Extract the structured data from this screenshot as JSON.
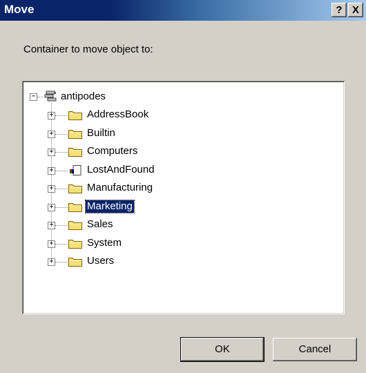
{
  "window": {
    "title": "Move",
    "help_glyph": "?",
    "close_glyph": "X"
  },
  "instruction": "Container to move object to:",
  "tree": {
    "root": {
      "label": "antipodes",
      "icon": "domain-icon",
      "expanded": true
    },
    "items": [
      {
        "label": "AddressBook",
        "icon": "folder-icon",
        "selected": false
      },
      {
        "label": "Builtin",
        "icon": "folder-icon",
        "selected": false
      },
      {
        "label": "Computers",
        "icon": "folder-icon",
        "selected": false
      },
      {
        "label": "LostAndFound",
        "icon": "lost-and-found-icon",
        "selected": false
      },
      {
        "label": "Manufacturing",
        "icon": "folder-icon",
        "selected": false
      },
      {
        "label": "Marketing",
        "icon": "folder-icon",
        "selected": true
      },
      {
        "label": "Sales",
        "icon": "folder-icon",
        "selected": false
      },
      {
        "label": "System",
        "icon": "folder-icon",
        "selected": false
      },
      {
        "label": "Users",
        "icon": "folder-icon",
        "selected": false
      }
    ]
  },
  "buttons": {
    "ok": "OK",
    "cancel": "Cancel"
  },
  "colors": {
    "titlebar": "#0a246a",
    "selection": "#0a246a",
    "folder": "#f5e17a",
    "face": "#d4d0c8"
  }
}
